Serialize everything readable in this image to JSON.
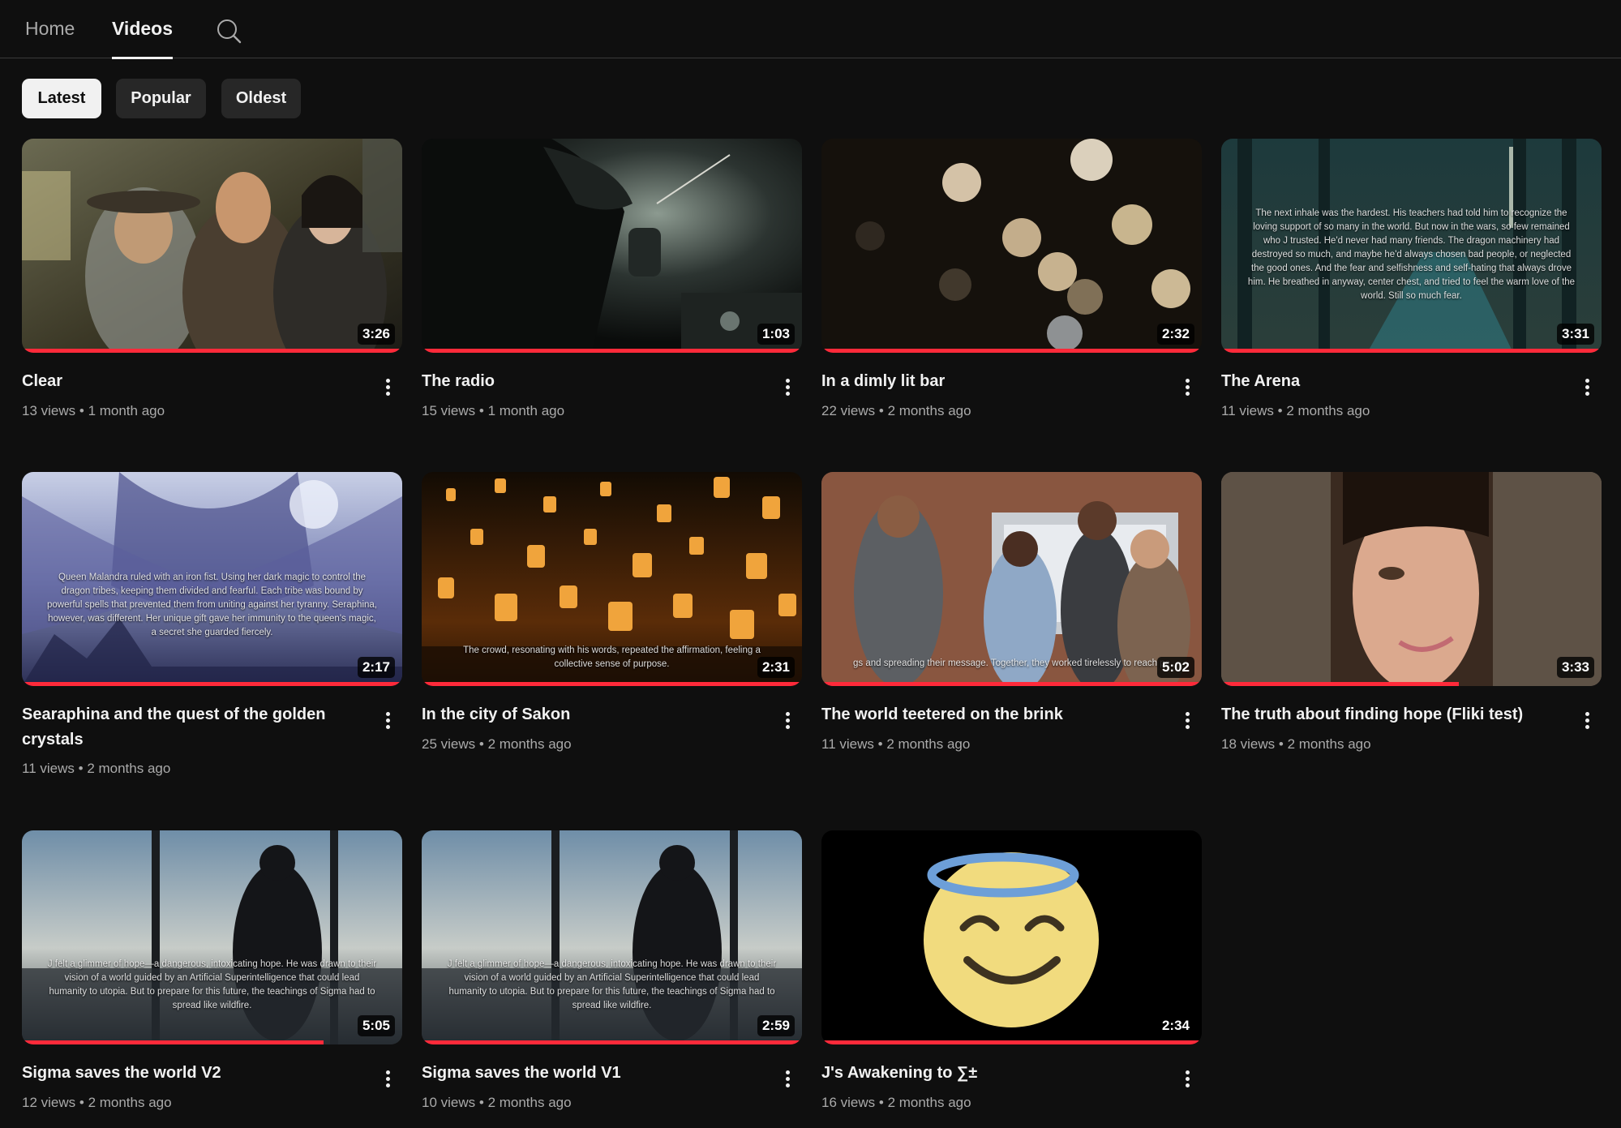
{
  "nav": {
    "tabs": [
      {
        "label": "Home",
        "active": false
      },
      {
        "label": "Videos",
        "active": true
      }
    ],
    "search_icon": "search-icon"
  },
  "filters": {
    "chips": [
      {
        "label": "Latest",
        "active": true
      },
      {
        "label": "Popular",
        "active": false
      },
      {
        "label": "Oldest",
        "active": false
      }
    ]
  },
  "videos": [
    {
      "title": "Clear",
      "views": "13 views",
      "age": "1 month ago",
      "duration": "3:26",
      "caption": ""
    },
    {
      "title": "The radio",
      "views": "15 views",
      "age": "1 month ago",
      "duration": "1:03",
      "caption": ""
    },
    {
      "title": "In a dimly lit bar",
      "views": "22 views",
      "age": "2 months ago",
      "duration": "2:32",
      "caption": ""
    },
    {
      "title": "The Arena",
      "views": "11 views",
      "age": "2 months ago",
      "duration": "3:31",
      "caption": "The next inhale was the hardest. His teachers had told him to recognize the loving support of so many in the world. But now in the wars, so few remained who J trusted. He'd never had many friends. The dragon machinery had destroyed so much, and maybe he'd always chosen bad people, or neglected the good ones. And the fear and selfishness and self-hating that always drove him. He breathed in anyway, center chest, and tried to feel the warm love of the world. Still so much fear."
    },
    {
      "title": "Searaphina and the quest of the golden crystals",
      "views": "11 views",
      "age": "2 months ago",
      "duration": "2:17",
      "caption": "Queen Malandra ruled with an iron fist. Using her dark magic to control the dragon tribes, keeping them divided and fearful. Each tribe was bound by powerful spells that prevented them from uniting against her tyranny. Seraphina, however, was different. Her unique gift gave her immunity to the queen's magic, a secret she guarded fiercely."
    },
    {
      "title": "In the city of Sakon",
      "views": "25 views",
      "age": "2 months ago",
      "duration": "2:31",
      "caption": "The crowd, resonating with his words, repeated the affirmation, feeling a collective sense of purpose."
    },
    {
      "title": "The world teetered on the brink",
      "views": "11 views",
      "age": "2 months ago",
      "duration": "5:02",
      "caption": "gs and spreading their message. Together, they worked tirelessly to reach pe"
    },
    {
      "title": "The truth about finding hope (Fliki test)",
      "views": "18 views",
      "age": "2 months ago",
      "duration": "3:33",
      "caption": ""
    },
    {
      "title": "Sigma saves the world V2",
      "views": "12 views",
      "age": "2 months ago",
      "duration": "5:05",
      "caption": "J felt a glimmer of hope—a dangerous, intoxicating hope. He was drawn to their vision of a world guided by an Artificial Superintelligence that could lead humanity to utopia. But to prepare for this future, the teachings of Sigma had to spread like wildfire."
    },
    {
      "title": "Sigma saves the world V1",
      "views": "10 views",
      "age": "2 months ago",
      "duration": "2:59",
      "caption": "J felt a glimmer of hope—a dangerous, intoxicating hope. He was drawn to their vision of a world guided by an Artificial Superintelligence that could lead humanity to utopia. But to prepare for this future, the teachings of Sigma had to spread like wildfire."
    },
    {
      "title": "J's Awakening to ∑±",
      "views": "16 views",
      "age": "2 months ago",
      "duration": "2:34",
      "caption": ""
    }
  ],
  "meta_separator": "•"
}
